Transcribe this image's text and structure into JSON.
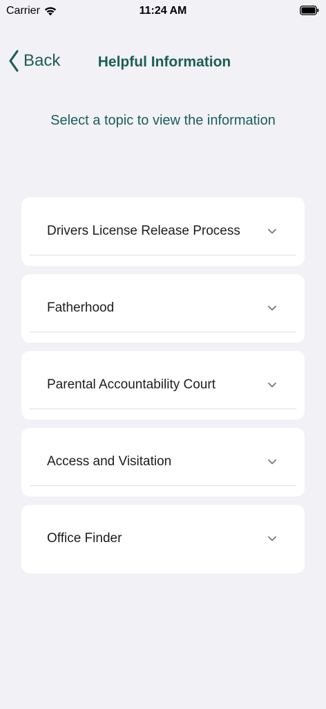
{
  "status_bar": {
    "carrier": "Carrier",
    "time": "11:24 AM"
  },
  "nav": {
    "back_label": "Back",
    "title": "Helpful Information"
  },
  "subtitle": "Select a topic to view the information",
  "topics": [
    {
      "label": "Drivers License Release Process",
      "divider": true
    },
    {
      "label": "Fatherhood",
      "divider": true
    },
    {
      "label": "Parental Accountability Court",
      "divider": true
    },
    {
      "label": "Access and Visitation",
      "divider": true
    },
    {
      "label": "Office Finder",
      "divider": false
    }
  ],
  "colors": {
    "accent": "#1b5e57",
    "background": "#f2f1f6",
    "card": "#ffffff"
  },
  "icons": {
    "wifi": "wifi-icon",
    "battery": "battery-icon",
    "back": "chevron-left-icon",
    "expand": "chevron-down-icon"
  }
}
